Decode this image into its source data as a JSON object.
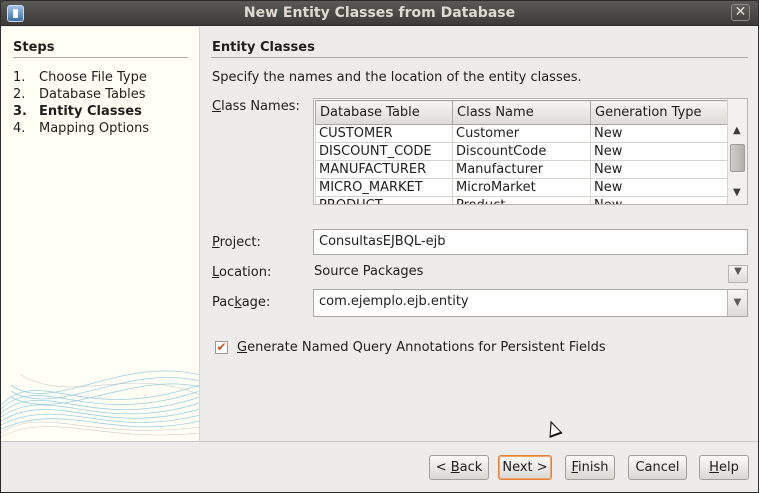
{
  "window": {
    "title": "New Entity Classes from Database",
    "close_glyph": "✕"
  },
  "steps": {
    "heading": "Steps",
    "items": [
      {
        "num": "1.",
        "label": "Choose File Type"
      },
      {
        "num": "2.",
        "label": "Database Tables"
      },
      {
        "num": "3.",
        "label": "Entity Classes"
      },
      {
        "num": "4.",
        "label": "Mapping Options"
      }
    ],
    "current_index": 2
  },
  "main": {
    "section_title": "Entity Classes",
    "description": "Specify the names and the location of the entity classes.",
    "class_names_label_first": "C",
    "class_names_label_rest": "lass Names:",
    "table": {
      "columns": [
        "Database Table",
        "Class Name",
        "Generation Type"
      ],
      "rows": [
        [
          "CUSTOMER",
          "Customer",
          "New"
        ],
        [
          "DISCOUNT_CODE",
          "DiscountCode",
          "New"
        ],
        [
          "MANUFACTURER",
          "Manufacturer",
          "New"
        ],
        [
          "MICRO_MARKET",
          "MicroMarket",
          "New"
        ],
        [
          "PRODUCT",
          "Product",
          "New"
        ]
      ]
    },
    "project_label_first": "P",
    "project_label_rest": "roject:",
    "project_value": "ConsultasEJBQL-ejb",
    "location_label_first": "L",
    "location_label_rest": "ocation:",
    "location_value": "Source Packages",
    "package_label_pre": "Pac",
    "package_label_u": "k",
    "package_label_rest": "age:",
    "package_value": "com.ejemplo.ejb.entity",
    "checkbox_label_first": "G",
    "checkbox_label_rest": "enerate Named Query Annotations for Persistent Fields",
    "checkbox_checked": true
  },
  "buttons": {
    "back_pre": "< ",
    "back_u": "B",
    "back_rest": "ack",
    "next": "Next >",
    "finish_u": "F",
    "finish_rest": "inish",
    "cancel": "Cancel",
    "help_u": "H",
    "help_rest": "elp"
  },
  "colors": {
    "accent_orange": "#e3803a",
    "steps_background": "#fffff5"
  }
}
